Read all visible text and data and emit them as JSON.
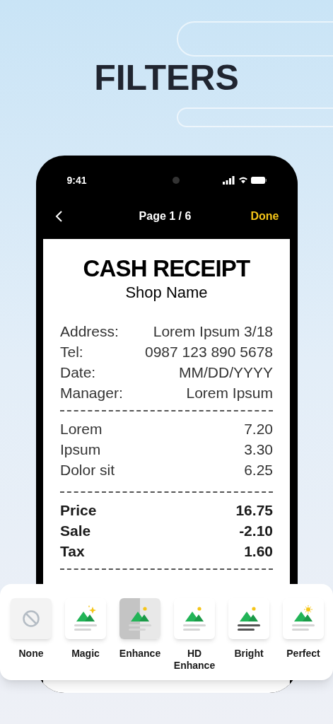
{
  "headline": "FILTERS",
  "status_bar": {
    "time": "9:41"
  },
  "nav": {
    "title": "Page 1 / 6",
    "done": "Done"
  },
  "receipt": {
    "title": "CASH RECEIPT",
    "subtitle": "Shop Name",
    "info": [
      {
        "label": "Address:",
        "value": "Lorem Ipsum 3/18"
      },
      {
        "label": "Tel:",
        "value": "0987 123 890 5678"
      },
      {
        "label": "Date:",
        "value": "MM/DD/YYYY"
      },
      {
        "label": "Manager:",
        "value": "Lorem Ipsum"
      }
    ],
    "items": [
      {
        "label": "Lorem",
        "value": "7.20"
      },
      {
        "label": "Ipsum",
        "value": "3.30"
      },
      {
        "label": "Dolor sit",
        "value": "6.25"
      }
    ],
    "totals": [
      {
        "label": "Price",
        "value": "16.75"
      },
      {
        "label": "Sale",
        "value": "-2.10"
      },
      {
        "label": "Tax",
        "value": "1.60"
      }
    ]
  },
  "filters": [
    {
      "kind": "none",
      "label": "None"
    },
    {
      "kind": "magic",
      "label": "Magic"
    },
    {
      "kind": "enhance",
      "label": "Enhance"
    },
    {
      "kind": "hd",
      "label": "HD Enhance"
    },
    {
      "kind": "bright",
      "label": "Bright"
    },
    {
      "kind": "perfect",
      "label": "Perfect"
    }
  ]
}
